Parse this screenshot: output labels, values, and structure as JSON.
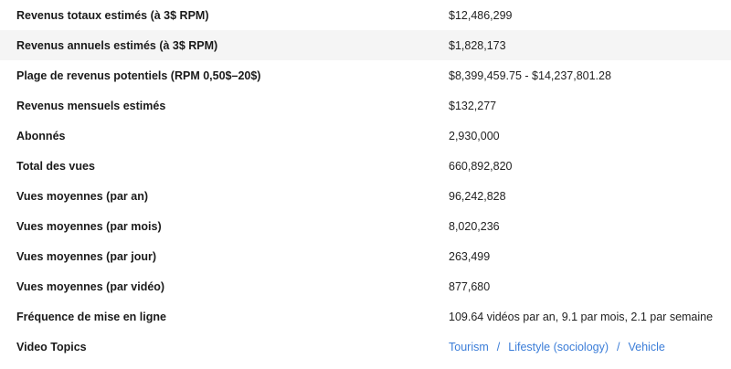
{
  "rows": [
    {
      "label": "Revenus totaux estimés (à 3$ RPM)",
      "value": "$12,486,299"
    },
    {
      "label": "Revenus annuels estimés (à 3$ RPM)",
      "value": "$1,828,173"
    },
    {
      "label": "Plage de revenus potentiels (RPM 0,50$–20$)",
      "value": "$8,399,459.75 - $14,237,801.28"
    },
    {
      "label": "Revenus mensuels estimés",
      "value": "$132,277"
    },
    {
      "label": "Abonnés",
      "value": "2,930,000"
    },
    {
      "label": "Total des vues",
      "value": "660,892,820"
    },
    {
      "label": "Vues moyennes (par an)",
      "value": "96,242,828"
    },
    {
      "label": "Vues moyennes (par mois)",
      "value": "8,020,236"
    },
    {
      "label": "Vues moyennes (par jour)",
      "value": "263,499"
    },
    {
      "label": "Vues moyennes (par vidéo)",
      "value": "877,680"
    },
    {
      "label": "Fréquence de mise en ligne",
      "value": "109.64 vidéos par an, 9.1 par mois, 2.1 par semaine"
    }
  ],
  "topics": {
    "label": "Video Topics",
    "separator": "/",
    "items": [
      "Tourism",
      "Lifestyle (sociology)",
      "Vehicle"
    ]
  },
  "colors": {
    "shaded_row": "#f5f5f5",
    "link": "#3b7dd8"
  }
}
